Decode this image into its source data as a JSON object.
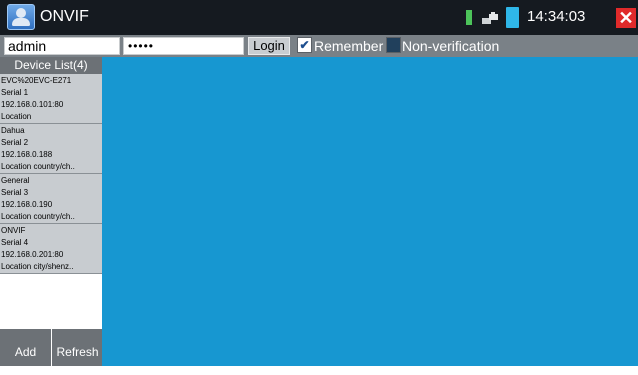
{
  "window": {
    "title": "ONVIF",
    "clock": "14:34:03",
    "close_symbol": "✕"
  },
  "login": {
    "username": "admin",
    "password_masked": "•••••",
    "login_label": "Login",
    "remember_label": "Remember",
    "remember_checked": true,
    "check_mark": "✔",
    "nonverification_label": "Non-verification",
    "nonverification_checked": false
  },
  "sidebar": {
    "header": "Device List(4)",
    "devices": [
      {
        "name": "EVC%20EVC-E271",
        "serial": "Serial 1",
        "address": "192.168.0.101:80",
        "location": "Location"
      },
      {
        "name": "Dahua",
        "serial": "Serial 2",
        "address": "192.168.0.188",
        "location": "Location country/ch.."
      },
      {
        "name": "General",
        "serial": "Serial 3",
        "address": "192.168.0.190",
        "location": "Location country/ch.."
      },
      {
        "name": "ONVIF",
        "serial": "Serial 4",
        "address": "192.168.0.201:80",
        "location": "Location city/shenz.."
      }
    ],
    "add_label": "Add",
    "refresh_label": "Refresh"
  },
  "colors": {
    "titlebar": "#151a20",
    "loginbar": "#7a8187",
    "video_area": "#1797d1",
    "close": "#e02a2a",
    "status_green": "#4cc35a",
    "battery": "#2fb7e9"
  },
  "icons": [
    "camera-app-icon",
    "status-green-icon",
    "network-icon",
    "battery-icon",
    "close-icon",
    "check-icon"
  ]
}
